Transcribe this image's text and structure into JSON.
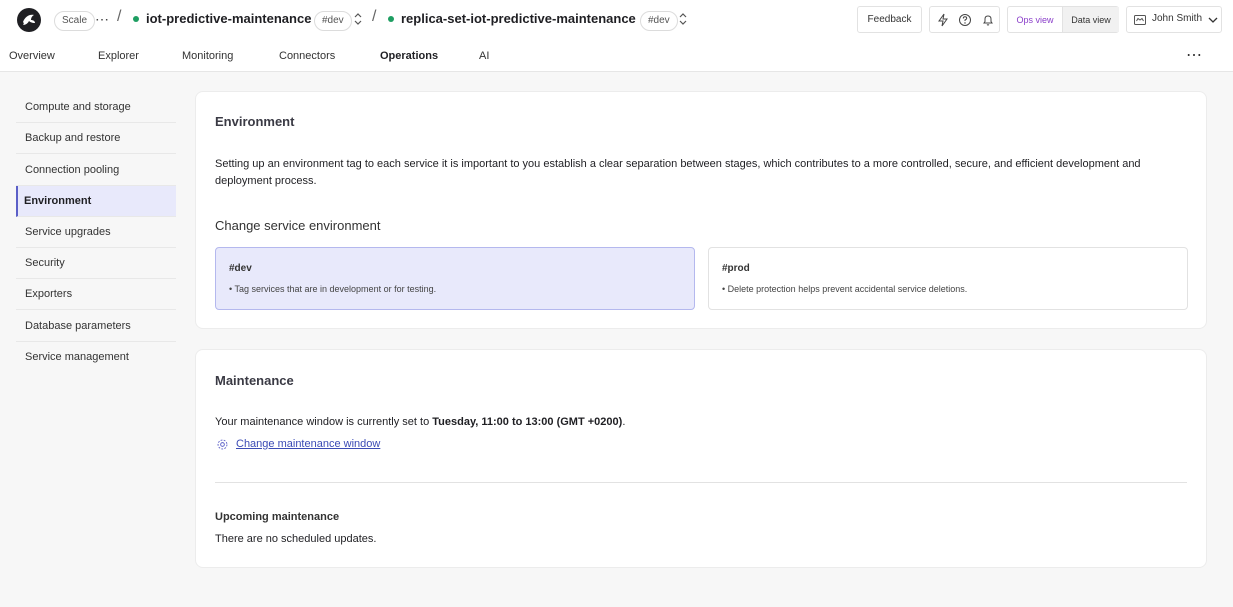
{
  "header": {
    "plan_badge": "Scale",
    "project_name": "iot-predictive-maintenance",
    "project_tag": "#dev",
    "service_name": "replica-set-iot-predictive-maintenance",
    "service_tag": "#dev",
    "feedback_label": "Feedback",
    "ops_view_label": "Ops view",
    "data_view_label": "Data view",
    "user_name": "John Smith"
  },
  "tabs": [
    {
      "label": "Overview"
    },
    {
      "label": "Explorer"
    },
    {
      "label": "Monitoring"
    },
    {
      "label": "Connectors"
    },
    {
      "label": "Operations"
    },
    {
      "label": "AI"
    }
  ],
  "sidebar": {
    "items": [
      {
        "label": "Compute and storage"
      },
      {
        "label": "Backup and restore"
      },
      {
        "label": "Connection pooling"
      },
      {
        "label": "Environment"
      },
      {
        "label": "Service upgrades"
      },
      {
        "label": "Security"
      },
      {
        "label": "Exporters"
      },
      {
        "label": "Database parameters"
      },
      {
        "label": "Service management"
      }
    ]
  },
  "environment": {
    "title": "Environment",
    "description": "Setting up an environment tag to each service it is important to you establish a clear separation between stages, which contributes to a more controlled, secure, and efficient development and deployment process.",
    "change_label": "Change service environment",
    "options": [
      {
        "name": "#dev",
        "desc": "• Tag services that are in development or for testing."
      },
      {
        "name": "#prod",
        "desc": "• Delete protection helps prevent accidental service deletions."
      }
    ]
  },
  "maintenance": {
    "title": "Maintenance",
    "window_prefix": "Your maintenance window is currently set to ",
    "window_value": "Tuesday, 11:00 to 13:00 (GMT +0200)",
    "window_suffix": ".",
    "change_link": "Change maintenance window",
    "upcoming_title": "Upcoming maintenance",
    "upcoming_text": "There are no scheduled updates."
  },
  "colors": {
    "accent": "#5b5fc7",
    "status_dot": "#1e9e62",
    "ops_view": "#8a3ec9",
    "link": "#3b4bb5"
  },
  "icons": [
    "logo-icon",
    "lightning-icon",
    "help-icon",
    "bell-icon",
    "crown-icon",
    "chevron-down-icon",
    "more-icon",
    "gear-icon",
    "updown-icon"
  ]
}
